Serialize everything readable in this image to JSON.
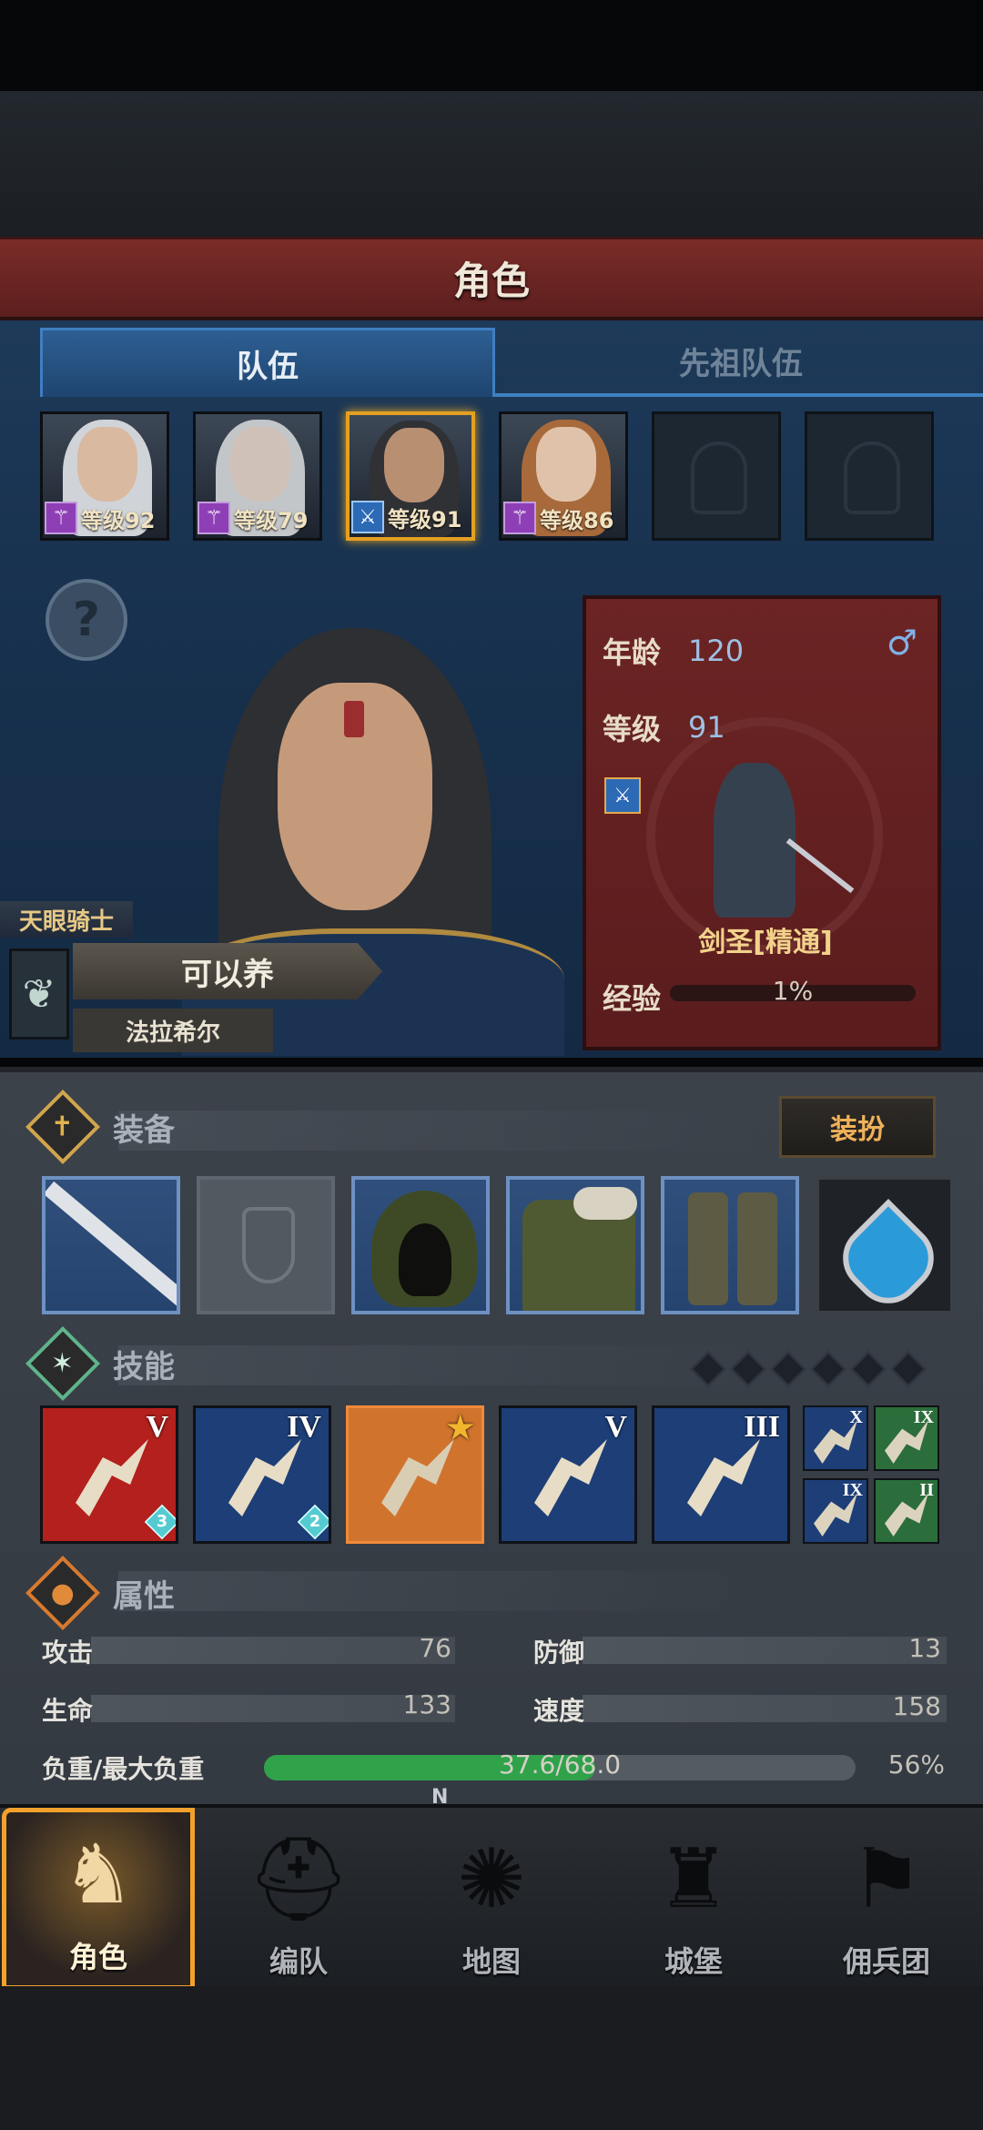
{
  "header": {
    "title": "角色"
  },
  "tabs": [
    {
      "label": "队伍",
      "active": true
    },
    {
      "label": "先祖队伍",
      "active": false
    }
  ],
  "members": [
    {
      "level": "等级92",
      "hair": "#d0d4d8",
      "class_icon": "staff-icon",
      "selected": false
    },
    {
      "level": "等级79",
      "hair": "#c3c6c9",
      "class_icon": "staff-icon",
      "selected": false
    },
    {
      "level": "等级91",
      "hair": "#2f3135",
      "class_icon": "sword-icon",
      "selected": true
    },
    {
      "level": "等级86",
      "hair": "#a86a3b",
      "class_icon": "staff-icon",
      "selected": false
    },
    {
      "empty": true
    },
    {
      "empty": true
    }
  ],
  "hero": {
    "class_title": "天眼骑士",
    "status": "可以养",
    "name": "法拉希尔"
  },
  "info": {
    "age_label": "年龄",
    "age": "120",
    "level_label": "等级",
    "level": "91",
    "job": "剑圣[精通]",
    "exp_label": "经验",
    "exp_percent": "1%",
    "exp_fraction": 0.01,
    "gender_icon": "male-icon"
  },
  "equipment": {
    "title": "装备",
    "dress_button": "装扮",
    "slots": [
      "sword",
      "shield-empty",
      "hood",
      "armor",
      "boots",
      "heart-amulet"
    ]
  },
  "skills": {
    "title": "技能",
    "pips": 6,
    "items": [
      {
        "rank": "V",
        "count": "3",
        "color": "#b3201d"
      },
      {
        "rank": "IV",
        "count": "2",
        "color": "#1d3e77"
      },
      {
        "rank": "★",
        "count": "",
        "color": "#d0732d"
      },
      {
        "rank": "V",
        "count": "",
        "color": "#1d3e77"
      },
      {
        "rank": "III",
        "count": "",
        "color": "#1d3e77"
      }
    ],
    "mini": [
      {
        "rank": "X",
        "color": "#1d3e77"
      },
      {
        "rank": "IX",
        "color": "#2b6e3b"
      },
      {
        "rank": "IX",
        "color": "#1d3e77"
      },
      {
        "rank": "II",
        "color": "#2b6e3b"
      }
    ]
  },
  "attributes": {
    "title": "属性",
    "attack_label": "攻击",
    "attack": "76",
    "defense_label": "防御",
    "defense": "13",
    "hp_label": "生命",
    "hp": "133",
    "speed_label": "速度",
    "speed": "158",
    "load_label": "负重/最大负重",
    "load": "37.6/68.0",
    "load_percent": "56%",
    "load_fraction": 0.56
  },
  "nav": [
    {
      "label": "角色",
      "icon": "knight-icon",
      "active": true
    },
    {
      "label": "编队",
      "icon": "helmet-icon",
      "active": false
    },
    {
      "label": "地图",
      "icon": "compass-icon",
      "active": false
    },
    {
      "label": "城堡",
      "icon": "castle-icon",
      "active": false
    },
    {
      "label": "佣兵团",
      "icon": "banner-icon",
      "active": false
    }
  ],
  "compass_letter": "N"
}
